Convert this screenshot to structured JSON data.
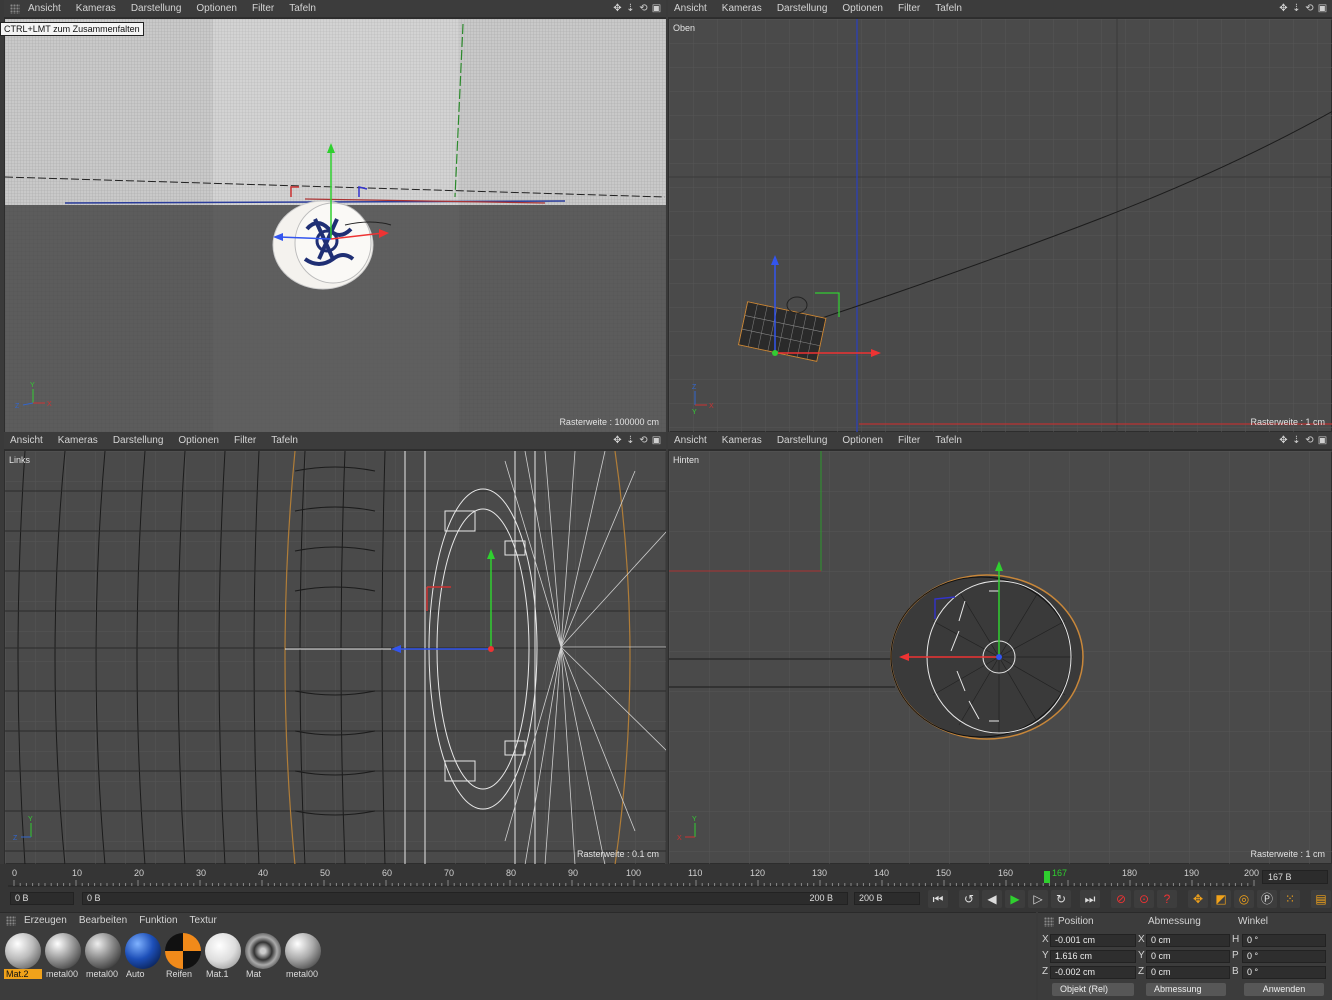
{
  "menu": [
    "Ansicht",
    "Kameras",
    "Darstellung",
    "Optionen",
    "Filter",
    "Tafeln"
  ],
  "tooltip": "CTRL+LMT zum Zusammenfalten",
  "viewports": {
    "top_left": {
      "label": "",
      "raster": "Rasterweite : 100000 cm"
    },
    "top_right": {
      "label": "Oben",
      "raster": "Rasterweite : 1 cm"
    },
    "bottom_left": {
      "label": "Links",
      "raster": "Rasterweite : 0.1 cm"
    },
    "bottom_right": {
      "label": "Hinten",
      "raster": "Rasterweite : 1 cm"
    }
  },
  "timeline": {
    "ticks": [
      "0",
      "10",
      "20",
      "30",
      "40",
      "50",
      "60",
      "70",
      "80",
      "90",
      "100",
      "110",
      "120",
      "130",
      "140",
      "150",
      "160",
      "170",
      "180",
      "190",
      "200"
    ],
    "current_frame": "167",
    "current_frame_field": "167 B",
    "start_field": "0 B",
    "range_start": "0 B",
    "range_end": "200 B",
    "end_field": "200 B"
  },
  "materials": {
    "menu": [
      "Erzeugen",
      "Bearbeiten",
      "Funktion",
      "Textur"
    ],
    "items": [
      {
        "name": "Mat.2",
        "selected": true
      },
      {
        "name": "metal00"
      },
      {
        "name": "metal00"
      },
      {
        "name": "Auto"
      },
      {
        "name": "Reifen"
      },
      {
        "name": "Mat.1"
      },
      {
        "name": "Mat"
      },
      {
        "name": "metal00"
      }
    ]
  },
  "coords": {
    "headers": {
      "position": "Position",
      "size": "Abmessung",
      "angle": "Winkel"
    },
    "rows": [
      {
        "axis": "X",
        "pos": "-0.001 cm",
        "size_axis": "X",
        "size": "0 cm",
        "ang_axis": "H",
        "ang": "0 °"
      },
      {
        "axis": "Y",
        "pos": "1.616 cm",
        "size_axis": "Y",
        "size": "0 cm",
        "ang_axis": "P",
        "ang": "0 °"
      },
      {
        "axis": "Z",
        "pos": "-0.002 cm",
        "size_axis": "Z",
        "size": "0 cm",
        "ang_axis": "B",
        "ang": "0 °"
      }
    ],
    "mode": "Objekt (Rel)",
    "size_mode": "Abmessung",
    "apply": "Anwenden"
  }
}
